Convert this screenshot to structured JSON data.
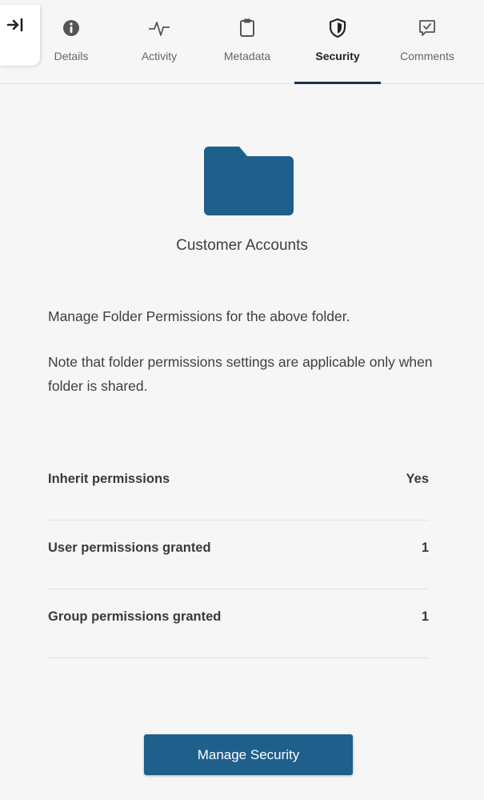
{
  "tabs": [
    {
      "id": "details",
      "label": "Details",
      "icon": "info-icon"
    },
    {
      "id": "activity",
      "label": "Activity",
      "icon": "activity-pulse-icon"
    },
    {
      "id": "metadata",
      "label": "Metadata",
      "icon": "clipboard-icon"
    },
    {
      "id": "security",
      "label": "Security",
      "icon": "shield-icon",
      "active": true
    },
    {
      "id": "comments",
      "label": "Comments",
      "icon": "comment-check-icon"
    }
  ],
  "collapse": {
    "icon": "collapse-panel-icon"
  },
  "folder": {
    "name": "Customer Accounts",
    "icon": "folder-icon",
    "color": "#1e5f8c"
  },
  "description": {
    "line1": "Manage Folder Permissions for the above folder.",
    "line2": "Note that folder permissions settings are applicable only when folder is shared."
  },
  "permissions": [
    {
      "label": "Inherit permissions",
      "value": "Yes"
    },
    {
      "label": "User permissions granted",
      "value": "1"
    },
    {
      "label": "Group permissions granted",
      "value": "1"
    }
  ],
  "actions": {
    "manage_security_label": "Manage Security"
  },
  "colors": {
    "accent": "#1e5f8c",
    "active_tab_underline": "#1e3250",
    "background": "#f6f6f6"
  }
}
